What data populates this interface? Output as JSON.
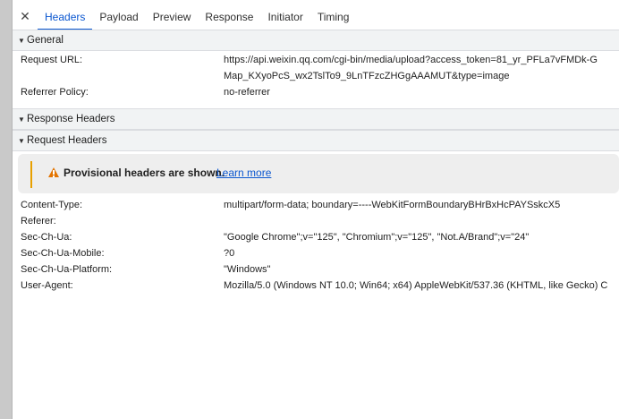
{
  "tabs": {
    "close_icon": "✕",
    "items": [
      "Headers",
      "Payload",
      "Preview",
      "Response",
      "Initiator",
      "Timing"
    ],
    "active": "Headers"
  },
  "general": {
    "title": "General",
    "rows": [
      {
        "key": "Request URL:",
        "value": "https://api.weixin.qq.com/cgi-bin/media/upload?access_token=81_yr_PFLa7vFMDk-G",
        "value2": "Map_KXyoPcS_wx2TslTo9_9LnTFzcZHGgAAAMUT&type=image"
      },
      {
        "key": "Referrer Policy:",
        "value": "no-referrer"
      }
    ]
  },
  "response_headers": {
    "title": "Response Headers"
  },
  "request_headers": {
    "title": "Request Headers",
    "warning": {
      "text": "Provisional headers are shown.",
      "link": "Learn more"
    },
    "rows": [
      {
        "key": "Content-Type:",
        "value": "multipart/form-data; boundary=----WebKitFormBoundaryBHrBxHcPAYSskcX5"
      },
      {
        "key": "Referer:",
        "value": ""
      },
      {
        "key": "Sec-Ch-Ua:",
        "value": "\"Google Chrome\";v=\"125\", \"Chromium\";v=\"125\", \"Not.A/Brand\";v=\"24\""
      },
      {
        "key": "Sec-Ch-Ua-Mobile:",
        "value": "?0"
      },
      {
        "key": "Sec-Ch-Ua-Platform:",
        "value": "\"Windows\""
      },
      {
        "key": "User-Agent:",
        "value": "Mozilla/5.0 (Windows NT 10.0; Win64; x64) AppleWebKit/537.36 (KHTML, like Gecko) C"
      }
    ]
  },
  "colors": {
    "accent": "#0b57d0",
    "section_bg": "#f1f3f4",
    "warning": "#e37400"
  }
}
